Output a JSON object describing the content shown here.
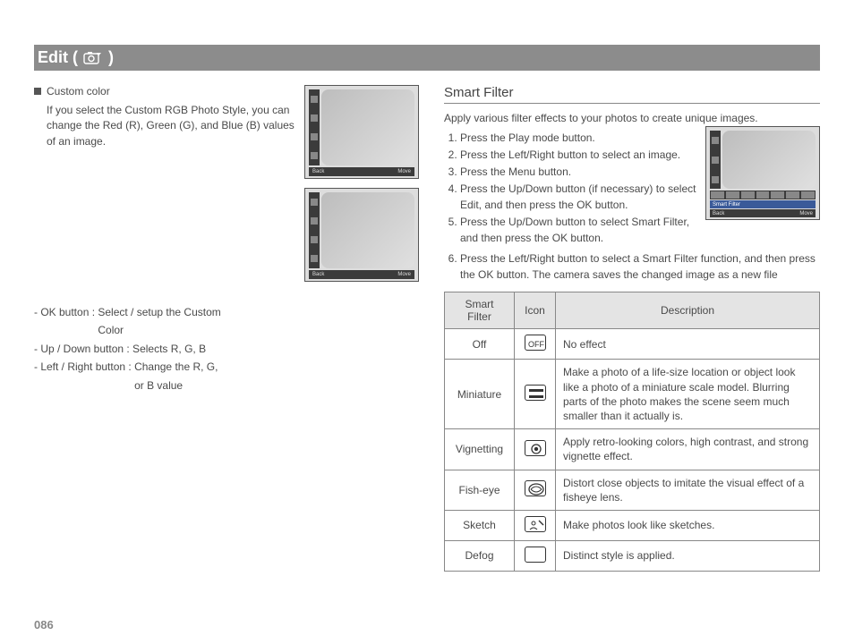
{
  "title": {
    "prefix": "Edit (",
    "suffix": ")"
  },
  "page_number": "086",
  "left": {
    "custom_color_heading": "Custom color",
    "custom_color_desc": "If you select the Custom RGB Photo Style, you can change the Red (R), Green (G), and Blue (B) values of an image.",
    "controls": [
      {
        "label": "- OK button",
        "desc": ": Select / setup the Custom Color",
        "indent": ""
      },
      {
        "label": "- Up / Down button ",
        "desc": ": Selects R, G, B",
        "indent": ""
      },
      {
        "label": "- Left / Right button ",
        "desc": ": Change the R, G, or B value",
        "indent": ""
      }
    ],
    "thumb_back": "Back",
    "thumb_move": "Move"
  },
  "right": {
    "section_title": "Smart Filter",
    "intro": "Apply various filter effects to your photos to create unique images.",
    "steps": [
      "Press the Play mode button.",
      "Press the Left/Right button to select an image.",
      "Press the Menu button.",
      "Press the Up/Down button (if necessary) to select Edit, and then press the OK button.",
      "Press the Up/Down button to select Smart Filter, and then press the OK button.",
      "Press the Left/Right button to select a Smart Filter function, and then press the OK button. The camera saves the changed image as a new file"
    ],
    "sf_thumb_label": "Smart Filter",
    "sf_thumb_back": "Back",
    "sf_thumb_move": "Move",
    "table": {
      "headers": {
        "h1": "Smart Filter",
        "h2": "Icon",
        "h3": "Description"
      },
      "rows": [
        {
          "name": "Off",
          "icon": "filter-off-icon",
          "desc": "No effect"
        },
        {
          "name": "Miniature",
          "icon": "miniature-icon",
          "desc": "Make a photo of a life-size location or object look like a photo of a miniature scale model. Blurring parts of the photo makes the scene seem much smaller than it actually is."
        },
        {
          "name": "Vignetting",
          "icon": "vignetting-icon",
          "desc": "Apply retro-looking colors, high contrast, and strong vignette effect."
        },
        {
          "name": "Fish-eye",
          "icon": "fisheye-icon",
          "desc": "Distort close objects to imitate the visual effect of a fisheye lens."
        },
        {
          "name": "Sketch",
          "icon": "sketch-icon",
          "desc": "Make photos look like sketches."
        },
        {
          "name": "Defog",
          "icon": "defog-icon",
          "desc": "Distinct style is applied."
        }
      ]
    }
  }
}
